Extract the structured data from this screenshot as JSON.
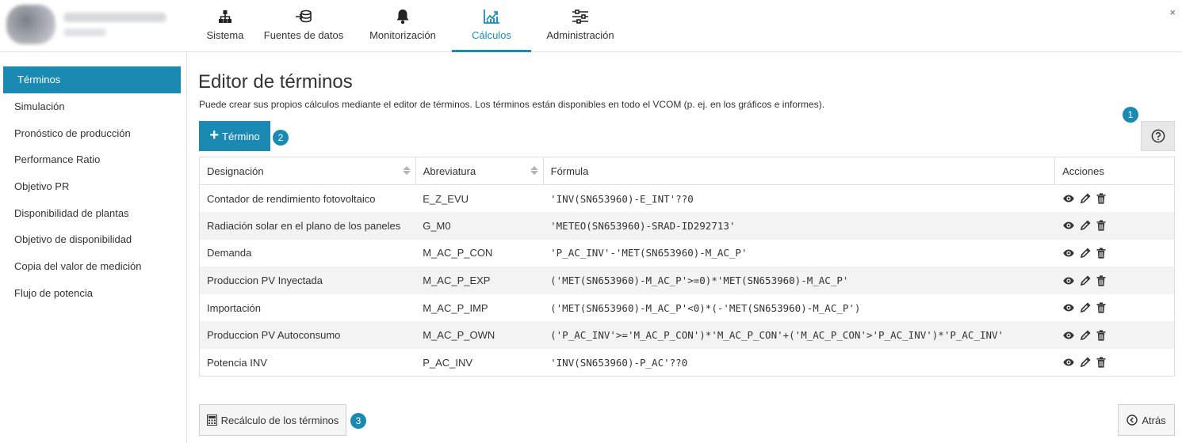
{
  "header": {
    "close": "×",
    "nav": [
      {
        "label": "Sistema",
        "icon": "sitemap-icon",
        "active": false
      },
      {
        "label": "Fuentes de datos",
        "icon": "database-import-icon",
        "active": false
      },
      {
        "label": "Monitorización",
        "icon": "bell-icon",
        "active": false
      },
      {
        "label": "Cálculos",
        "icon": "chart-line-icon",
        "active": true
      },
      {
        "label": "Administración",
        "icon": "sliders-icon",
        "active": false
      }
    ]
  },
  "sidebar": {
    "items": [
      {
        "label": "Términos",
        "active": true
      },
      {
        "label": "Simulación"
      },
      {
        "label": "Pronóstico de producción"
      },
      {
        "label": "Performance Ratio"
      },
      {
        "label": "Objetivo PR"
      },
      {
        "label": "Disponibilidad de plantas"
      },
      {
        "label": "Objetivo de disponibilidad"
      },
      {
        "label": "Copia del valor de medición"
      },
      {
        "label": "Flujo de potencia"
      }
    ]
  },
  "main": {
    "title": "Editor de términos",
    "description": "Puede crear sus propios cálculos mediante el editor de términos. Los términos están disponibles en todo el VCOM (p. ej. en los gráficos e informes).",
    "add_button": "Término",
    "badges": [
      "1",
      "2",
      "3"
    ],
    "table": {
      "columns": [
        "Designación",
        "Abreviatura",
        "Fórmula",
        "Acciones"
      ],
      "rows": [
        {
          "designacion": "Contador de rendimiento fotovoltaico",
          "abreviatura": "E_Z_EVU",
          "formula": "'INV(SN653960)-E_INT'??0"
        },
        {
          "designacion": "Radiación solar en el plano de los paneles",
          "abreviatura": "G_M0",
          "formula": "'METEO(SN653960)-SRAD-ID292713'"
        },
        {
          "designacion": "Demanda",
          "abreviatura": "M_AC_P_CON",
          "formula": "'P_AC_INV'-'MET(SN653960)-M_AC_P'"
        },
        {
          "designacion": "Produccion PV Inyectada",
          "abreviatura": "M_AC_P_EXP",
          "formula": "('MET(SN653960)-M_AC_P'>=0)*'MET(SN653960)-M_AC_P'"
        },
        {
          "designacion": "Importación",
          "abreviatura": "M_AC_P_IMP",
          "formula": "('MET(SN653960)-M_AC_P'<0)*(-'MET(SN653960)-M_AC_P')"
        },
        {
          "designacion": "Produccion PV Autoconsumo",
          "abreviatura": "M_AC_P_OWN",
          "formula": "('P_AC_INV'>='M_AC_P_CON')*'M_AC_P_CON'+('M_AC_P_CON'>'P_AC_INV')*'P_AC_INV'"
        },
        {
          "designacion": "Potencia INV",
          "abreviatura": "P_AC_INV",
          "formula": "'INV(SN653960)-P_AC'??0"
        }
      ]
    },
    "recalc_button": "Recálculo de los términos",
    "back_button": "Atrás"
  },
  "colors": {
    "accent": "#1b8ab3",
    "row_alt": "#f3f3f3"
  }
}
